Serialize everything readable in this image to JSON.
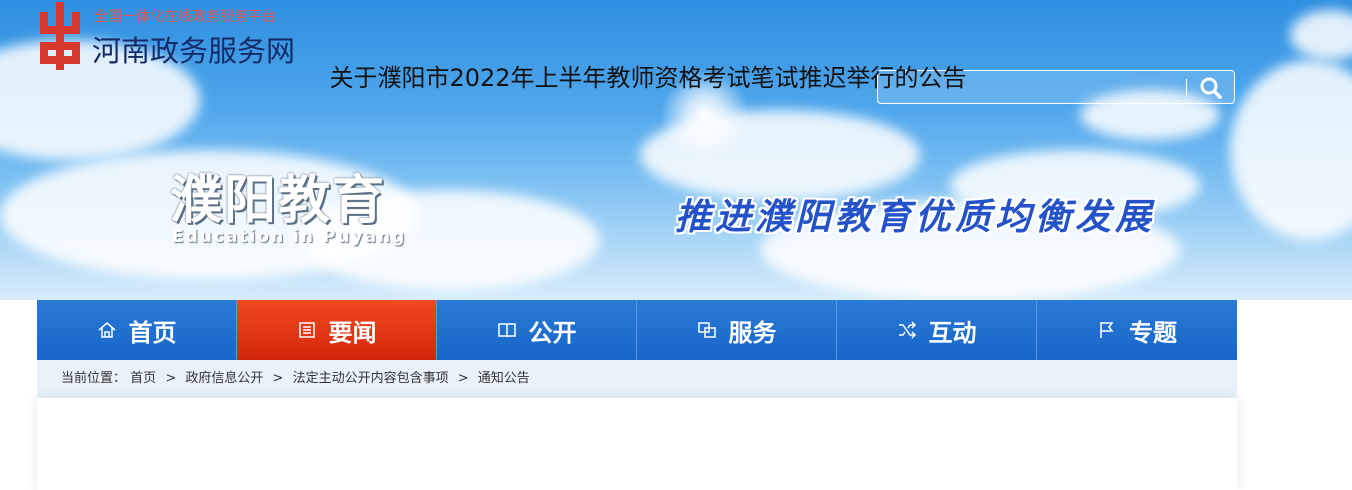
{
  "brand": {
    "subtitle": "全国一体化在线政务服务平台",
    "name": "河南政务服务网",
    "logo_icon": "henan-gov-logo"
  },
  "search": {
    "placeholder": "",
    "icon": "search-icon"
  },
  "site": {
    "title": "濮阳教育",
    "subtitle": "Education in Puyang",
    "slogan": "推进濮阳教育优质均衡发展"
  },
  "nav": {
    "items": [
      {
        "label": "首页",
        "icon": "home-icon",
        "active": false
      },
      {
        "label": "要闻",
        "icon": "news-icon",
        "active": true
      },
      {
        "label": "公开",
        "icon": "book-icon",
        "active": false
      },
      {
        "label": "服务",
        "icon": "service-icon",
        "active": false
      },
      {
        "label": "互动",
        "icon": "shuffle-icon",
        "active": false
      },
      {
        "label": "专题",
        "icon": "flag-icon",
        "active": false
      }
    ]
  },
  "breadcrumb": {
    "prefix": "当前位置：",
    "items": [
      "首页",
      "政府信息公开",
      "法定主动公开内容包含事项",
      "通知公告"
    ],
    "separator": ">"
  },
  "article": {
    "title": "关于濮阳市2022年上半年教师资格考试笔试推迟举行的公告"
  },
  "colors": {
    "nav_bg": "#1d6ccd",
    "nav_active": "#e0381a",
    "breadcrumb_bg": "#e9f2fb",
    "slogan": "#2452c9",
    "brand_name": "#152b67",
    "brand_subtitle": "#e3574c"
  }
}
